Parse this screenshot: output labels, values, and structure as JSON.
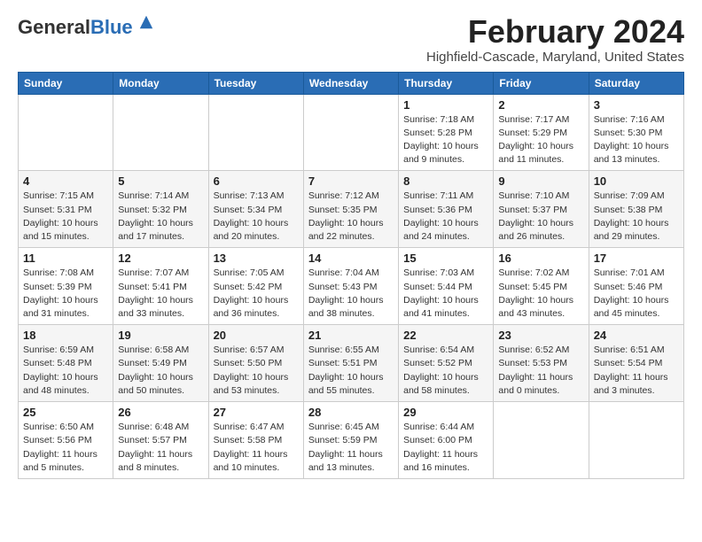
{
  "logo": {
    "general": "General",
    "blue": "Blue"
  },
  "title": "February 2024",
  "location": "Highfield-Cascade, Maryland, United States",
  "headers": [
    "Sunday",
    "Monday",
    "Tuesday",
    "Wednesday",
    "Thursday",
    "Friday",
    "Saturday"
  ],
  "weeks": [
    [
      {
        "day": "",
        "info": ""
      },
      {
        "day": "",
        "info": ""
      },
      {
        "day": "",
        "info": ""
      },
      {
        "day": "",
        "info": ""
      },
      {
        "day": "1",
        "info": "Sunrise: 7:18 AM\nSunset: 5:28 PM\nDaylight: 10 hours\nand 9 minutes."
      },
      {
        "day": "2",
        "info": "Sunrise: 7:17 AM\nSunset: 5:29 PM\nDaylight: 10 hours\nand 11 minutes."
      },
      {
        "day": "3",
        "info": "Sunrise: 7:16 AM\nSunset: 5:30 PM\nDaylight: 10 hours\nand 13 minutes."
      }
    ],
    [
      {
        "day": "4",
        "info": "Sunrise: 7:15 AM\nSunset: 5:31 PM\nDaylight: 10 hours\nand 15 minutes."
      },
      {
        "day": "5",
        "info": "Sunrise: 7:14 AM\nSunset: 5:32 PM\nDaylight: 10 hours\nand 17 minutes."
      },
      {
        "day": "6",
        "info": "Sunrise: 7:13 AM\nSunset: 5:34 PM\nDaylight: 10 hours\nand 20 minutes."
      },
      {
        "day": "7",
        "info": "Sunrise: 7:12 AM\nSunset: 5:35 PM\nDaylight: 10 hours\nand 22 minutes."
      },
      {
        "day": "8",
        "info": "Sunrise: 7:11 AM\nSunset: 5:36 PM\nDaylight: 10 hours\nand 24 minutes."
      },
      {
        "day": "9",
        "info": "Sunrise: 7:10 AM\nSunset: 5:37 PM\nDaylight: 10 hours\nand 26 minutes."
      },
      {
        "day": "10",
        "info": "Sunrise: 7:09 AM\nSunset: 5:38 PM\nDaylight: 10 hours\nand 29 minutes."
      }
    ],
    [
      {
        "day": "11",
        "info": "Sunrise: 7:08 AM\nSunset: 5:39 PM\nDaylight: 10 hours\nand 31 minutes."
      },
      {
        "day": "12",
        "info": "Sunrise: 7:07 AM\nSunset: 5:41 PM\nDaylight: 10 hours\nand 33 minutes."
      },
      {
        "day": "13",
        "info": "Sunrise: 7:05 AM\nSunset: 5:42 PM\nDaylight: 10 hours\nand 36 minutes."
      },
      {
        "day": "14",
        "info": "Sunrise: 7:04 AM\nSunset: 5:43 PM\nDaylight: 10 hours\nand 38 minutes."
      },
      {
        "day": "15",
        "info": "Sunrise: 7:03 AM\nSunset: 5:44 PM\nDaylight: 10 hours\nand 41 minutes."
      },
      {
        "day": "16",
        "info": "Sunrise: 7:02 AM\nSunset: 5:45 PM\nDaylight: 10 hours\nand 43 minutes."
      },
      {
        "day": "17",
        "info": "Sunrise: 7:01 AM\nSunset: 5:46 PM\nDaylight: 10 hours\nand 45 minutes."
      }
    ],
    [
      {
        "day": "18",
        "info": "Sunrise: 6:59 AM\nSunset: 5:48 PM\nDaylight: 10 hours\nand 48 minutes."
      },
      {
        "day": "19",
        "info": "Sunrise: 6:58 AM\nSunset: 5:49 PM\nDaylight: 10 hours\nand 50 minutes."
      },
      {
        "day": "20",
        "info": "Sunrise: 6:57 AM\nSunset: 5:50 PM\nDaylight: 10 hours\nand 53 minutes."
      },
      {
        "day": "21",
        "info": "Sunrise: 6:55 AM\nSunset: 5:51 PM\nDaylight: 10 hours\nand 55 minutes."
      },
      {
        "day": "22",
        "info": "Sunrise: 6:54 AM\nSunset: 5:52 PM\nDaylight: 10 hours\nand 58 minutes."
      },
      {
        "day": "23",
        "info": "Sunrise: 6:52 AM\nSunset: 5:53 PM\nDaylight: 11 hours\nand 0 minutes."
      },
      {
        "day": "24",
        "info": "Sunrise: 6:51 AM\nSunset: 5:54 PM\nDaylight: 11 hours\nand 3 minutes."
      }
    ],
    [
      {
        "day": "25",
        "info": "Sunrise: 6:50 AM\nSunset: 5:56 PM\nDaylight: 11 hours\nand 5 minutes."
      },
      {
        "day": "26",
        "info": "Sunrise: 6:48 AM\nSunset: 5:57 PM\nDaylight: 11 hours\nand 8 minutes."
      },
      {
        "day": "27",
        "info": "Sunrise: 6:47 AM\nSunset: 5:58 PM\nDaylight: 11 hours\nand 10 minutes."
      },
      {
        "day": "28",
        "info": "Sunrise: 6:45 AM\nSunset: 5:59 PM\nDaylight: 11 hours\nand 13 minutes."
      },
      {
        "day": "29",
        "info": "Sunrise: 6:44 AM\nSunset: 6:00 PM\nDaylight: 11 hours\nand 16 minutes."
      },
      {
        "day": "",
        "info": ""
      },
      {
        "day": "",
        "info": ""
      }
    ]
  ]
}
